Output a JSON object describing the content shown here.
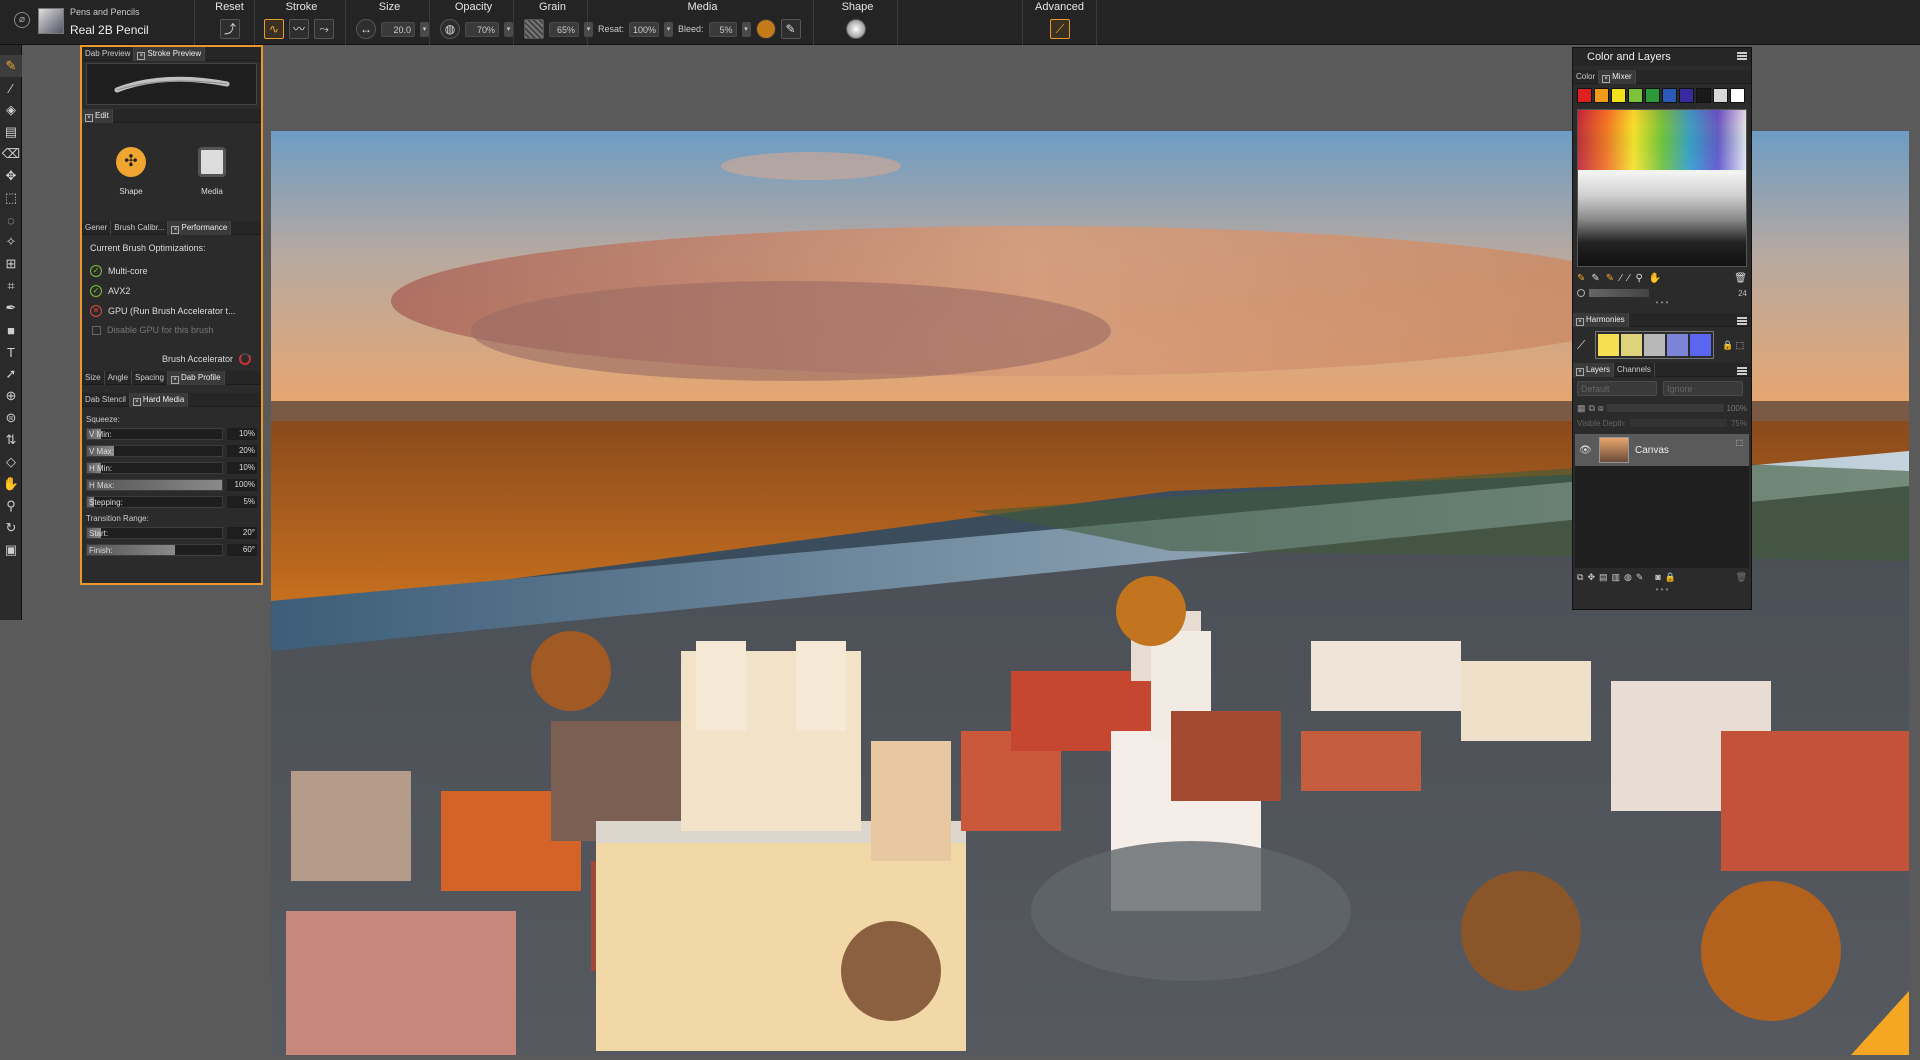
{
  "toolbar": {
    "brush_category": "Pens and Pencils",
    "brush_variant": "Real 2B Pencil",
    "sections": {
      "reset": "Reset",
      "stroke": "Stroke",
      "size": "Size",
      "opacity": "Opacity",
      "grain": "Grain",
      "media": "Media",
      "shape": "Shape",
      "advanced": "Advanced"
    },
    "size_value": "20.0",
    "opacity_value": "70%",
    "grain_value": "65%",
    "resat_label": "Resat:",
    "resat_value": "100%",
    "bleed_label": "Bleed:",
    "bleed_value": "5%"
  },
  "brush_panel": {
    "tabs_top": [
      "Dab Preview",
      "Stroke Preview"
    ],
    "edit_tab": "Edit",
    "shape_label": "Shape",
    "media_label": "Media",
    "tabs_mid": [
      "Gener",
      "Brush Calibr...",
      "Performance"
    ],
    "optim_title": "Current Brush Optimizations:",
    "optims": [
      "Multi-core",
      "AVX2",
      "GPU (Run Brush Accelerator t..."
    ],
    "disable_gpu": "Disable GPU for this brush",
    "accelerator": "Brush Accelerator",
    "tabs_bottom1": [
      "Size",
      "Angle",
      "Spacing",
      "Dab Profile"
    ],
    "tabs_bottom2": [
      "Dab Stencil",
      "Hard Media"
    ],
    "squeeze": "Squeeze:",
    "sliders": [
      {
        "label": "V Min:",
        "value": "10%",
        "fill": 0.1
      },
      {
        "label": "V Max:",
        "value": "20%",
        "fill": 0.2
      },
      {
        "label": "H Min:",
        "value": "10%",
        "fill": 0.1
      },
      {
        "label": "H Max:",
        "value": "100%",
        "fill": 1.0
      },
      {
        "label": "Stepping:",
        "value": "5%",
        "fill": 0.05
      }
    ],
    "transition": "Transition Range:",
    "transition_sliders": [
      {
        "label": "Start:",
        "value": "20°",
        "fill": 0.1
      },
      {
        "label": "Finish:",
        "value": "60°",
        "fill": 0.65
      }
    ]
  },
  "color_layers": {
    "title": "Color and Layers",
    "color_tabs": [
      "Color",
      "Mixer"
    ],
    "swatches": [
      "#e02020",
      "#f29b1b",
      "#f2e21b",
      "#7cc33b",
      "#2a9a3a",
      "#2a59b8",
      "#3a2aa0",
      "#1a1a1a",
      "#d8d8d8",
      "#ffffff"
    ],
    "mixer_size": "24",
    "harmonies": "Harmonies",
    "harmony_colors": [
      "#f5df52",
      "#e0d27a",
      "#b8b8b8",
      "#7c84d8",
      "#5a66f0"
    ],
    "layer_tabs": [
      "Layers",
      "Channels"
    ],
    "blend_mode": "Default",
    "composite": "Ignore",
    "opacity": "100%",
    "visible_depth_label": "Visible Depth:",
    "visible_depth": "75%",
    "layer_name": "Canvas"
  }
}
